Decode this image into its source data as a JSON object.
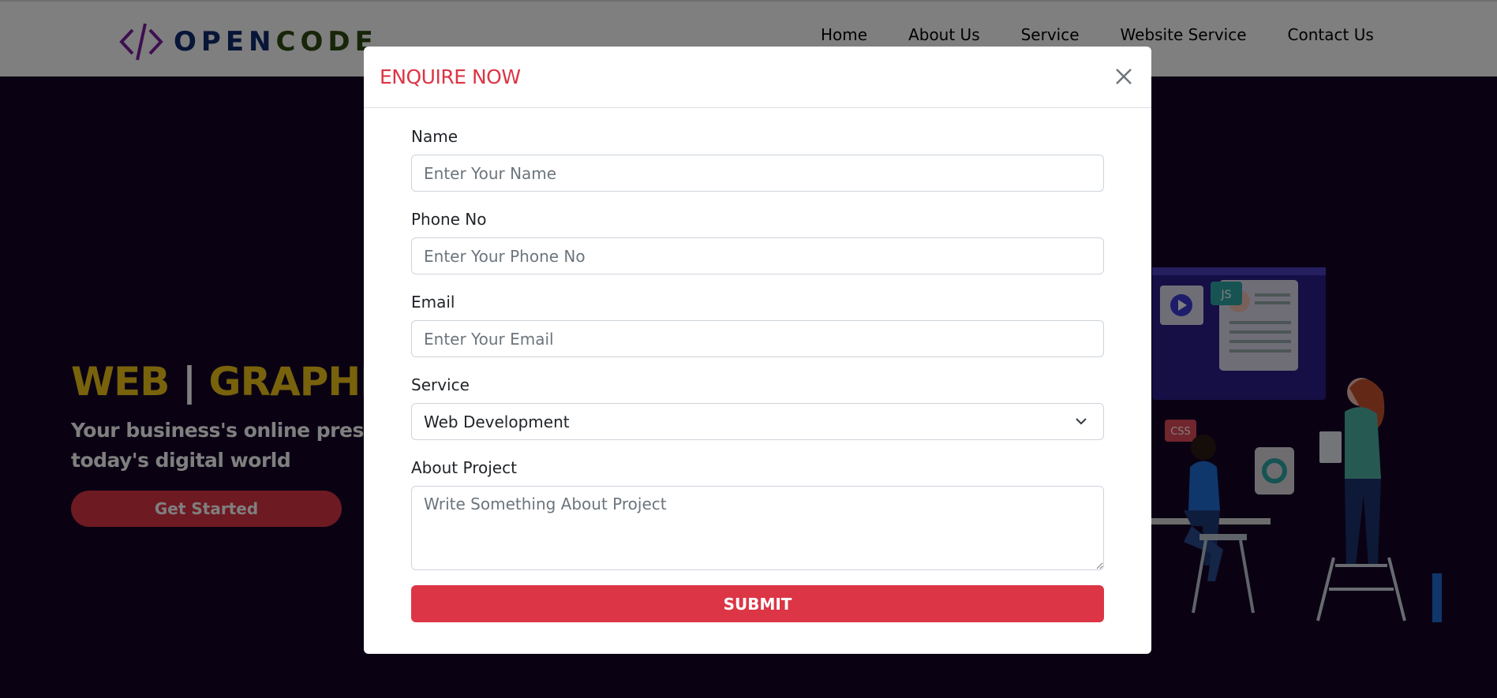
{
  "brand": {
    "logo_open": "OPEN",
    "logo_code": "CODE"
  },
  "nav": {
    "items": [
      "Home",
      "About Us",
      "Service",
      "Website Service",
      "Contact Us"
    ]
  },
  "hero": {
    "title_part1": "WEB",
    "title_sep": "|",
    "title_part2": "GRAPHIC",
    "subtitle": "Your business's online presence today's digital world",
    "cta_label": "Get Started"
  },
  "modal": {
    "title": "ENQUIRE NOW",
    "fields": {
      "name": {
        "label": "Name",
        "placeholder": "Enter Your Name"
      },
      "phone": {
        "label": "Phone No",
        "placeholder": "Enter Your Phone No"
      },
      "email": {
        "label": "Email",
        "placeholder": "Enter Your Email"
      },
      "service": {
        "label": "Service",
        "value": "Web Development"
      },
      "about": {
        "label": "About Project",
        "placeholder": "Write Something About Project"
      }
    },
    "submit_label": "SUBMIT"
  },
  "illustration": {
    "js_badge": "JS",
    "css_badge": "CSS"
  },
  "colors": {
    "accent": "#dc3545",
    "hero_bg": "#140426",
    "title_yellow": "#f0c419"
  }
}
